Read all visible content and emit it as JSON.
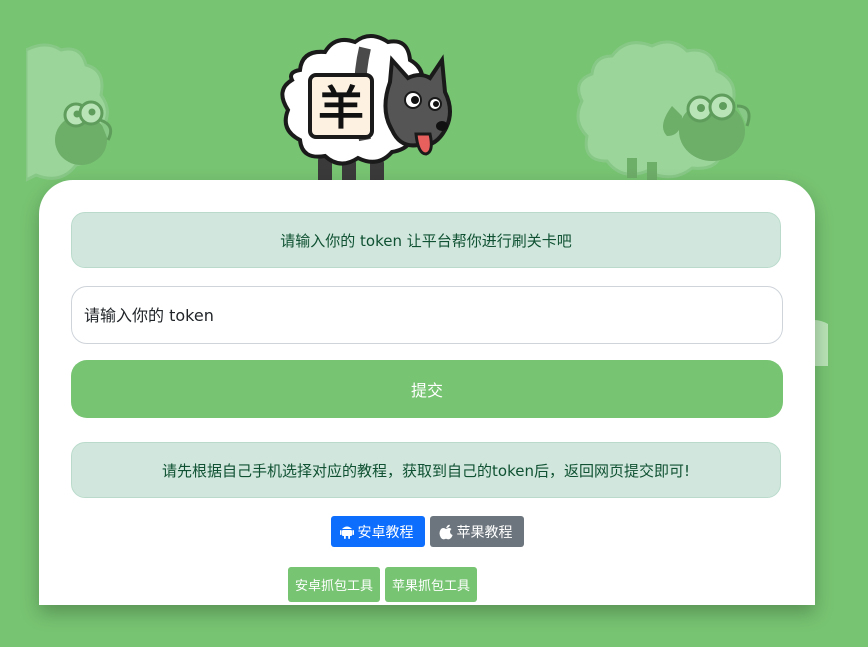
{
  "colors": {
    "background": "#77c472",
    "alert_bg": "#d1e7dd",
    "alert_text": "#0f5132",
    "android_button": "#0d6efd",
    "apple_button": "#6c757d"
  },
  "mascot": {
    "sign_char": "羊"
  },
  "main": {
    "intro_alert": "请输入你的 token 让平台帮你进行刷关卡吧",
    "token_placeholder": "请输入你的 token",
    "submit_label": "提交",
    "guide_alert": "请先根据自己手机选择对应的教程，获取到自己的token后，返回网页提交即可!",
    "tutorials": {
      "android_label": "安卓教程",
      "android_icon": "android-icon",
      "apple_label": "苹果教程",
      "apple_icon": "apple-icon"
    },
    "tools": {
      "android_label": "安卓抓包工具",
      "apple_label": "苹果抓包工具"
    }
  }
}
